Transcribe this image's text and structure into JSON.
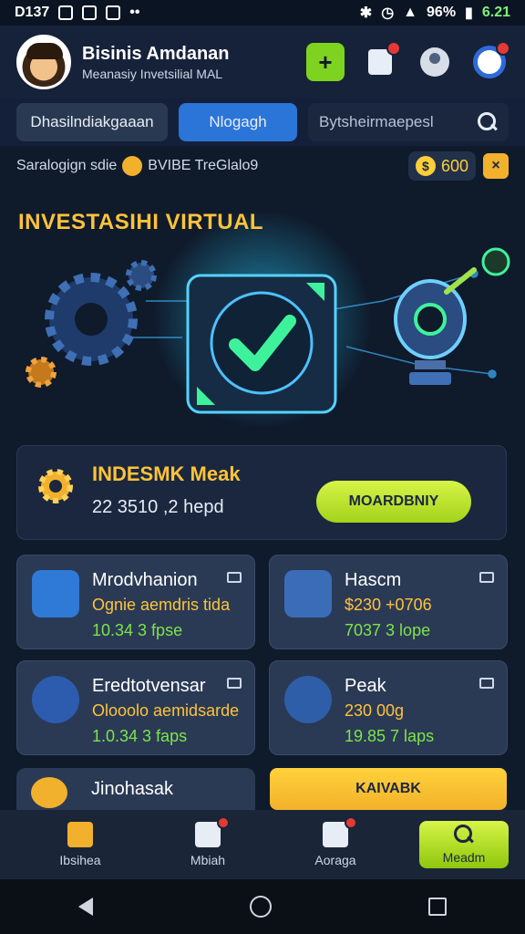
{
  "status": {
    "left": "D137",
    "battery": "96%",
    "time": "6.21"
  },
  "header": {
    "name": "Bisinis Amdanan",
    "subtitle": "Meanasiy Invetsilial MAL",
    "add_label": "+"
  },
  "tabs": {
    "dashboard": "Dhasilndiakgaaan",
    "active": "Nlogagh",
    "search_placeholder": "Bytsheirmaepesl"
  },
  "info_strip": {
    "text_left": "Saralogign sdie",
    "text_right": "BVIBE TreGlalo9",
    "coins": "600",
    "coin_symbol": "$",
    "close": "×"
  },
  "hero": {
    "title": "INVESTASIHI VIRTUAL"
  },
  "feature": {
    "title": "INDESMK Meak",
    "subtitle": "22 3510 ,2 hepd",
    "button": "MOARDBNIY"
  },
  "cards": [
    {
      "title": "Mrodvhanion",
      "sub": "Ognie aemdris tida",
      "meta": "10.34 3 fpse"
    },
    {
      "title": "Hascm",
      "sub": "$230 +0706",
      "meta": "7037 3 lope"
    },
    {
      "title": "Eredtotvensar",
      "sub": "Olooolo aemidsarde",
      "meta": "1.0.34 3 faps"
    },
    {
      "title": "Peak",
      "sub": "230 00g",
      "meta": "19.85 7 laps"
    }
  ],
  "bottom_card": {
    "title": "Jinohasak"
  },
  "kb_button": "KAIVABK",
  "nav": {
    "home": "Ibsihea",
    "box": "Mbiah",
    "chart": "Aoraga",
    "search": "Meadm"
  },
  "colors": {
    "accent": "#ffc33a",
    "primary": "#2b74d8",
    "lime": "#b7e12b",
    "bg": "#0f1a2b"
  }
}
